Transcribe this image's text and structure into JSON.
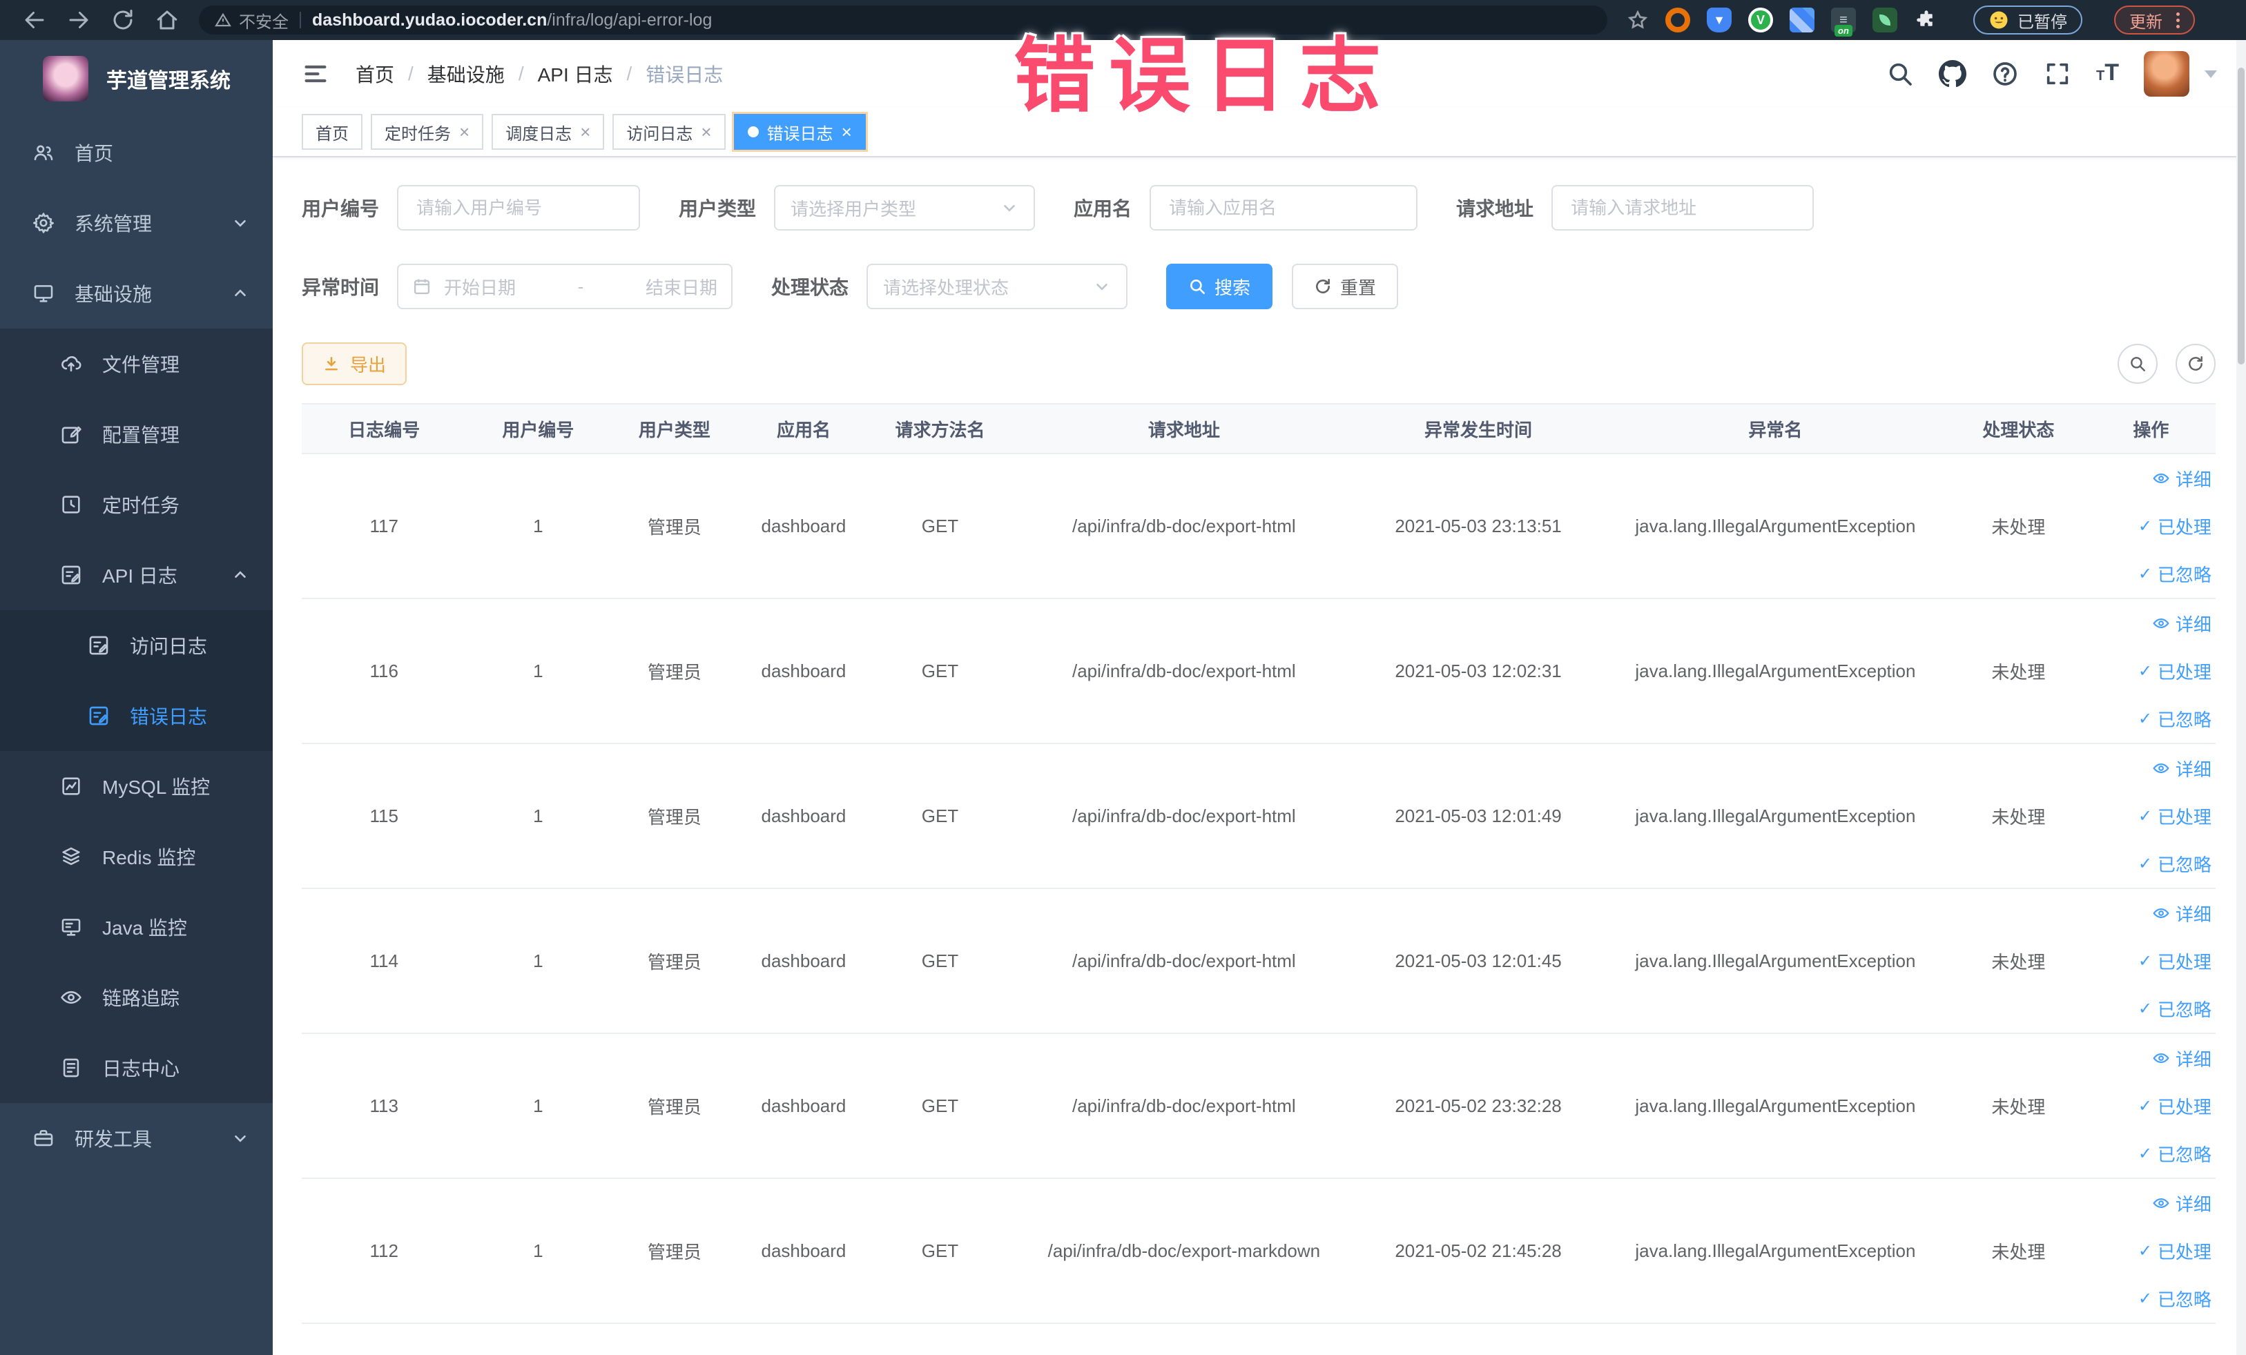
{
  "colors": {
    "accent": "#409eff",
    "warning": "#e6a23c",
    "overlay_pink": "#fa4a6e",
    "sidebar_bg": "#304156"
  },
  "browser": {
    "insecure_label": "不安全",
    "url_host": "dashboard.yudao.iocoder.cn",
    "url_path": "/infra/log/api-error-log",
    "paused_label": "已暂停",
    "update_label": "更新"
  },
  "overlay_title": "错误日志",
  "sidebar": {
    "app_title": "芋道管理系统",
    "items": [
      {
        "label": "首页"
      },
      {
        "label": "系统管理"
      },
      {
        "label": "基础设施"
      },
      {
        "label": "文件管理"
      },
      {
        "label": "配置管理"
      },
      {
        "label": "定时任务"
      },
      {
        "label": "API 日志"
      },
      {
        "label": "访问日志"
      },
      {
        "label": "错误日志"
      },
      {
        "label": "MySQL 监控"
      },
      {
        "label": "Redis 监控"
      },
      {
        "label": "Java 监控"
      },
      {
        "label": "链路追踪"
      },
      {
        "label": "日志中心"
      },
      {
        "label": "研发工具"
      }
    ]
  },
  "header": {
    "breadcrumb": [
      {
        "label": "首页"
      },
      {
        "label": "基础设施"
      },
      {
        "label": "API 日志"
      },
      {
        "label": "错误日志"
      }
    ]
  },
  "tabs": [
    {
      "label": "首页"
    },
    {
      "label": "定时任务"
    },
    {
      "label": "调度日志"
    },
    {
      "label": "访问日志"
    },
    {
      "label": "错误日志"
    }
  ],
  "filters": {
    "user_id_label": "用户编号",
    "user_id_placeholder": "请输入用户编号",
    "user_type_label": "用户类型",
    "user_type_placeholder": "请选择用户类型",
    "app_name_label": "应用名",
    "app_name_placeholder": "请输入应用名",
    "request_url_label": "请求地址",
    "request_url_placeholder": "请输入请求地址",
    "time_label": "异常时间",
    "time_start_placeholder": "开始日期",
    "time_separator": "-",
    "time_end_placeholder": "结束日期",
    "status_label": "处理状态",
    "status_placeholder": "请选择处理状态",
    "search_label": "搜索",
    "reset_label": "重置"
  },
  "toolbar": {
    "export_label": "导出"
  },
  "table": {
    "columns": [
      "日志编号",
      "用户编号",
      "用户类型",
      "应用名",
      "请求方法名",
      "请求地址",
      "异常发生时间",
      "异常名",
      "处理状态",
      "操作"
    ],
    "action_labels": [
      "详细",
      "已处理",
      "已忽略"
    ],
    "rows": [
      {
        "id": "117",
        "user_id": "1",
        "user_type": "管理员",
        "app": "dashboard",
        "method": "GET",
        "url": "/api/infra/db-doc/export-html",
        "time": "2021-05-03 23:13:51",
        "exception": "java.lang.IllegalArgumentException",
        "status": "未处理"
      },
      {
        "id": "116",
        "user_id": "1",
        "user_type": "管理员",
        "app": "dashboard",
        "method": "GET",
        "url": "/api/infra/db-doc/export-html",
        "time": "2021-05-03 12:02:31",
        "exception": "java.lang.IllegalArgumentException",
        "status": "未处理"
      },
      {
        "id": "115",
        "user_id": "1",
        "user_type": "管理员",
        "app": "dashboard",
        "method": "GET",
        "url": "/api/infra/db-doc/export-html",
        "time": "2021-05-03 12:01:49",
        "exception": "java.lang.IllegalArgumentException",
        "status": "未处理"
      },
      {
        "id": "114",
        "user_id": "1",
        "user_type": "管理员",
        "app": "dashboard",
        "method": "GET",
        "url": "/api/infra/db-doc/export-html",
        "time": "2021-05-03 12:01:45",
        "exception": "java.lang.IllegalArgumentException",
        "status": "未处理"
      },
      {
        "id": "113",
        "user_id": "1",
        "user_type": "管理员",
        "app": "dashboard",
        "method": "GET",
        "url": "/api/infra/db-doc/export-html",
        "time": "2021-05-02 23:32:28",
        "exception": "java.lang.IllegalArgumentException",
        "status": "未处理"
      },
      {
        "id": "112",
        "user_id": "1",
        "user_type": "管理员",
        "app": "dashboard",
        "method": "GET",
        "url": "/api/infra/db-doc/export-markdown",
        "time": "2021-05-02 21:45:28",
        "exception": "java.lang.IllegalArgumentException",
        "status": "未处理"
      }
    ]
  }
}
